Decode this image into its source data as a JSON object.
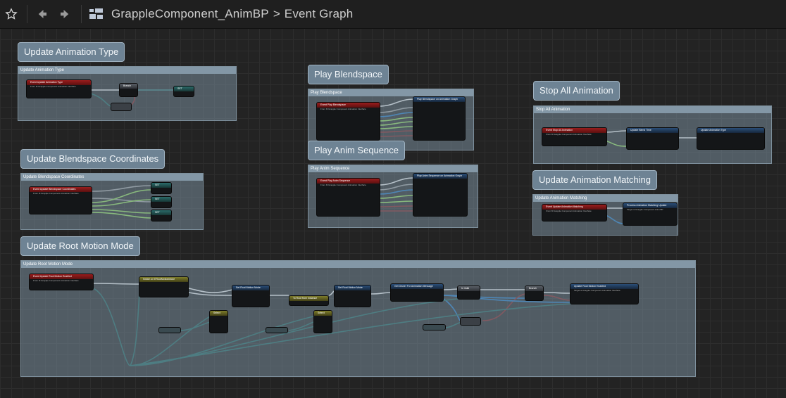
{
  "toolbar": {
    "breadcrumb_asset": "GrappleComponent_AnimBP",
    "breadcrumb_separator": ">",
    "breadcrumb_graph": "Event Graph",
    "icons": [
      "star-icon",
      "back-arrow-icon",
      "forward-arrow-icon",
      "blueprint-graph-icon"
    ]
  },
  "comments": [
    {
      "bubble": "Update Animation Type",
      "title": "Update Animation Type"
    },
    {
      "bubble": "Play Blendspace",
      "title": "Play Blendspace"
    },
    {
      "bubble": "Stop All Animation",
      "title": "Stop All Animation"
    },
    {
      "bubble": "Update Blendspace Coordinates",
      "title": "Update Blendspace Coordinates"
    },
    {
      "bubble": "Play Anim Sequence",
      "title": "Play Anim Sequence"
    },
    {
      "bubble": "Update Animation Matching",
      "title": "Update Animation Matching"
    },
    {
      "bubble": "Update Root Motion Mode",
      "title": "Update Root Motion Mode"
    }
  ],
  "nodes": {
    "update_anim_type_event": {
      "title": "Event Update Animation Type",
      "sub": "From M Grapple Component Animation Interface"
    },
    "update_anim_type_branch": {
      "title": "Branch"
    },
    "update_anim_type_set": {
      "title": "SET"
    },
    "play_blendspace_event": {
      "title": "Event Play Blendspace",
      "sub": "From M Grapple Component Animation Interface"
    },
    "play_blendspace_call": {
      "title": "Play Blendspace on Animation Graph"
    },
    "stop_all_event": {
      "title": "Event Stop All Animation",
      "sub": "From M Grapple Component Animation Interface"
    },
    "stop_all_blend": {
      "title": "Update Blend Time"
    },
    "stop_all_type": {
      "title": "Update Animation Type"
    },
    "update_bs_event": {
      "title": "Event Update Blendspace Coordinates",
      "sub": "From M Grapple Component Animation Interface"
    },
    "update_bs_set": {
      "title": "SET"
    },
    "play_seq_event": {
      "title": "Event Play Anim Sequence",
      "sub": "From M Grapple Component Animation Interface"
    },
    "play_seq_call": {
      "title": "Play Anim Sequence on Animation Graph"
    },
    "matching_event": {
      "title": "Event Update Animation Matching",
      "sub": "From M Grapple Component Animation Interface"
    },
    "matching_call": {
      "title": "Process Animation Matching Update",
      "sub": "Target is Grapple Component Anim BP"
    },
    "root_event": {
      "title": "Event Update Root Motion Enabled",
      "sub": "From M Grapple Component Animation Interface"
    },
    "root_switch": {
      "title": "Switch on ERootMotionMode"
    },
    "root_select_1": {
      "title": "Select"
    },
    "root_select_2": {
      "title": "Select"
    },
    "root_set_mode_1": {
      "title": "Set Root Motion Mode"
    },
    "root_set_mode_2": {
      "title": "Set Root Motion Mode"
    },
    "root_from_instance": {
      "title": "To Root from Instance"
    },
    "root_get_owner": {
      "title": "Get Owner For Animation Message"
    },
    "root_valid": {
      "title": "Is Valid"
    },
    "root_branch": {
      "title": "Branch"
    },
    "root_update": {
      "title": "Update Root Motion Enabled",
      "sub": "Target is Grapple Component Animation Interface"
    }
  },
  "colors": {
    "exec_wire": "#ffffff",
    "bool_wire": "#8e1b1b",
    "float_wire": "#9cf05a",
    "object_wire": "#1b7fd6",
    "enum_wire": "#1b6a64",
    "event_header": "#9a1d1d",
    "function_header": "#2a4e78",
    "comment_bubble": "#6e8394"
  }
}
